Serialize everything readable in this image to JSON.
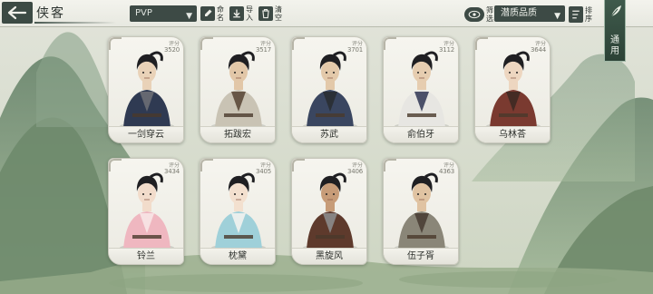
{
  "header": {
    "title": "侠客",
    "mode_select": "PVP",
    "tools": [
      {
        "name": "preset-button",
        "label": "命名",
        "icon": "brush-icon"
      },
      {
        "name": "import-button",
        "label": "导入",
        "icon": "download-icon"
      },
      {
        "name": "clear-button",
        "label": "清空",
        "icon": "trash-icon"
      }
    ],
    "filter_label": "筛选",
    "quality_select": "潜质品质",
    "sort_label": "排序",
    "universal_tab": "通用"
  },
  "colors": {
    "dark_button": "#3d4a45",
    "panel_light": "#f0f0ea",
    "tab_green": "#2c4236"
  },
  "cards": [
    {
      "name": "一剑穿云",
      "power_label": "评分",
      "power": "3520",
      "robe": "#2f3a52",
      "accent": "#6b6e74",
      "skin": "#e9d2b8"
    },
    {
      "name": "拓跋宏",
      "power_label": "评分",
      "power": "3517",
      "robe": "#c9c3b4",
      "accent": "#5c4a3a",
      "skin": "#e2c7a8"
    },
    {
      "name": "苏武",
      "power_label": "评分",
      "power": "3701",
      "robe": "#3a4660",
      "accent": "#2a2d33",
      "skin": "#e3c9aa"
    },
    {
      "name": "俞伯牙",
      "power_label": "评分",
      "power": "3112",
      "robe": "#e7e6e2",
      "accent": "#3a3f5c",
      "skin": "#e6cdb0"
    },
    {
      "name": "乌林荅",
      "power_label": "评分",
      "power": "3644",
      "robe": "#7a3a30",
      "accent": "#3e2a24",
      "skin": "#edd6c0"
    },
    {
      "name": "铃兰",
      "power_label": "评分",
      "power": "3434",
      "robe": "#efb7c0",
      "accent": "#f7e6e6",
      "skin": "#f2dccb"
    },
    {
      "name": "枕黛",
      "power_label": "评分",
      "power": "3405",
      "robe": "#9fd0d9",
      "accent": "#f2f2ee",
      "skin": "#f3e0cf"
    },
    {
      "name": "黑旋风",
      "power_label": "评分",
      "power": "3406",
      "robe": "#5e3a2c",
      "accent": "#8c8c8c",
      "skin": "#c79c78"
    },
    {
      "name": "伍子胥",
      "power_label": "评分",
      "power": "4363",
      "robe": "#8a8678",
      "accent": "#4a3f35",
      "skin": "#e0c3a2"
    }
  ]
}
